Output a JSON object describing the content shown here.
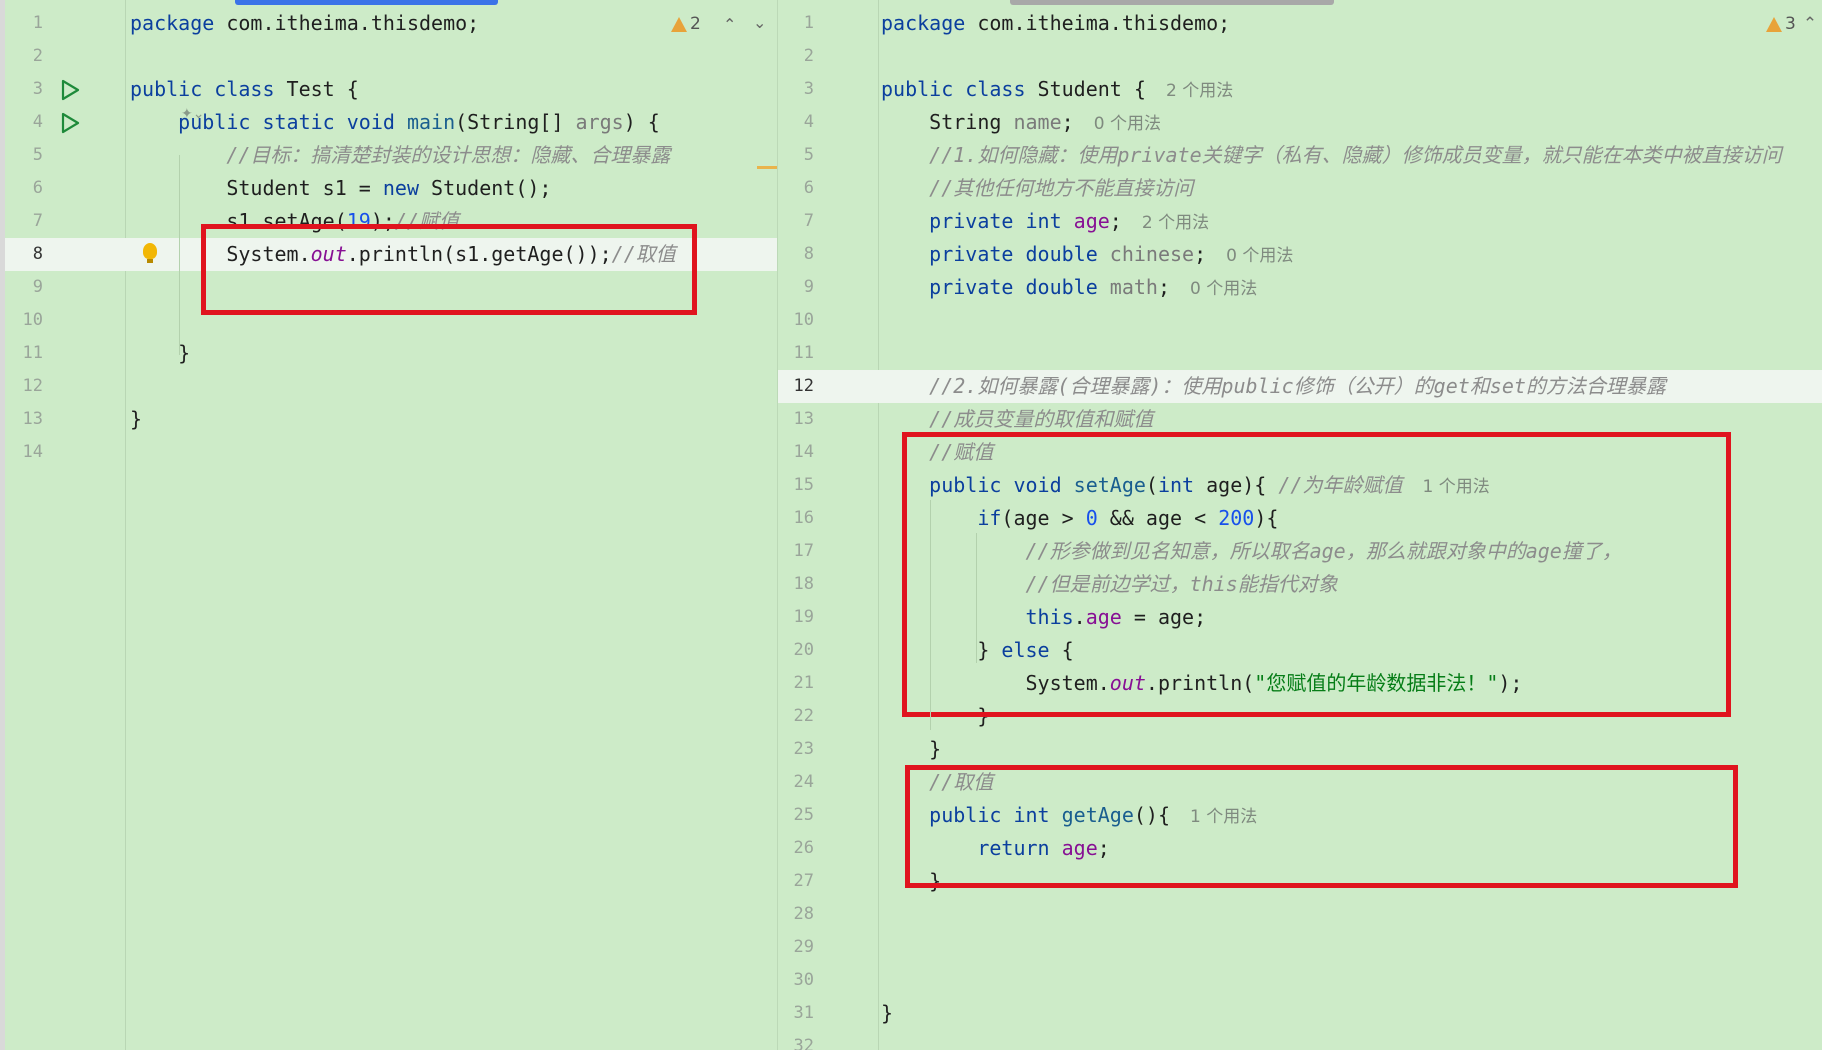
{
  "left": {
    "scrollbar_color": "#3b73e8",
    "warnings": {
      "icon": "warning-icon",
      "count": "2",
      "up_icon": "chevron-up-icon",
      "down_icon": "chevron-down-icon"
    },
    "lines": [
      {
        "n": "1",
        "tokens": [
          {
            "t": "package ",
            "c": "kw"
          },
          {
            "t": "com.itheima.thisdemo;",
            "c": ""
          }
        ]
      },
      {
        "n": "2",
        "tokens": []
      },
      {
        "n": "3",
        "tokens": [
          {
            "t": "public class ",
            "c": "kw"
          },
          {
            "t": "Test {",
            "c": ""
          }
        ],
        "run": true
      },
      {
        "n": "4",
        "tokens": [
          {
            "t": "    public static void ",
            "c": "kw"
          },
          {
            "t": "main",
            "c": "fn"
          },
          {
            "t": "(String[] ",
            "c": ""
          },
          {
            "t": "args",
            "c": "par"
          },
          {
            "t": ") {",
            "c": ""
          }
        ],
        "run": true
      },
      {
        "n": "5",
        "tokens": [
          {
            "t": "        //目标：搞清楚封装的设计思想：隐藏、合理暴露",
            "c": "cm"
          }
        ]
      },
      {
        "n": "6",
        "tokens": [
          {
            "t": "        Student s1 = ",
            "c": ""
          },
          {
            "t": "new ",
            "c": "kw"
          },
          {
            "t": "Student();",
            "c": ""
          }
        ]
      },
      {
        "n": "7",
        "tokens": [
          {
            "t": "        s1.setAge(",
            "c": ""
          },
          {
            "t": "19",
            "c": "num"
          },
          {
            "t": ");",
            "c": ""
          },
          {
            "t": "//赋值",
            "c": "cm"
          }
        ]
      },
      {
        "n": "8",
        "tokens": [
          {
            "t": "        System.",
            "c": ""
          },
          {
            "t": "out",
            "c": "st"
          },
          {
            "t": ".println(s1.getAge());",
            "c": ""
          },
          {
            "t": "//取值",
            "c": "cm"
          }
        ],
        "current": true,
        "bulb": true
      },
      {
        "n": "9",
        "tokens": []
      },
      {
        "n": "10",
        "tokens": []
      },
      {
        "n": "11",
        "tokens": [
          {
            "t": "    }",
            "c": ""
          }
        ]
      },
      {
        "n": "12",
        "tokens": []
      },
      {
        "n": "13",
        "tokens": [
          {
            "t": "}",
            "c": ""
          }
        ]
      },
      {
        "n": "14",
        "tokens": []
      }
    ]
  },
  "right": {
    "scrollbar_color": "#a8a8a8",
    "warnings": {
      "icon": "warning-icon",
      "count": "3"
    },
    "lines": [
      {
        "n": "1",
        "tokens": [
          {
            "t": "package ",
            "c": "kw"
          },
          {
            "t": "com.itheima.thisdemo;",
            "c": ""
          }
        ]
      },
      {
        "n": "2",
        "tokens": []
      },
      {
        "n": "3",
        "tokens": [
          {
            "t": "public class ",
            "c": "kw"
          },
          {
            "t": "Student { ",
            "c": ""
          }
        ],
        "hint": "2 个用法"
      },
      {
        "n": "4",
        "tokens": [
          {
            "t": "    String ",
            "c": ""
          },
          {
            "t": "name",
            "c": "par"
          },
          {
            "t": "; ",
            "c": ""
          }
        ],
        "hint": "0 个用法"
      },
      {
        "n": "5",
        "tokens": [
          {
            "t": "    //1.如何隐藏：使用private关键字（私有、隐藏）修饰成员变量，就只能在本类中被直接访问",
            "c": "cm"
          }
        ]
      },
      {
        "n": "6",
        "tokens": [
          {
            "t": "    //其他任何地方不能直接访问",
            "c": "cm"
          }
        ]
      },
      {
        "n": "7",
        "tokens": [
          {
            "t": "    private int ",
            "c": "kw"
          },
          {
            "t": "age",
            "c": "fld"
          },
          {
            "t": "; ",
            "c": ""
          }
        ],
        "hint": "2 个用法"
      },
      {
        "n": "8",
        "tokens": [
          {
            "t": "    private double ",
            "c": "kw"
          },
          {
            "t": "chinese",
            "c": "par"
          },
          {
            "t": "; ",
            "c": ""
          }
        ],
        "hint": "0 个用法"
      },
      {
        "n": "9",
        "tokens": [
          {
            "t": "    private double ",
            "c": "kw"
          },
          {
            "t": "math",
            "c": "par"
          },
          {
            "t": "; ",
            "c": ""
          }
        ],
        "hint": "0 个用法"
      },
      {
        "n": "10",
        "tokens": []
      },
      {
        "n": "11",
        "tokens": []
      },
      {
        "n": "12",
        "tokens": [
          {
            "t": "    //2.如何暴露(合理暴露)：使用public修饰（公开）的get和set的方法合理暴露",
            "c": "cm"
          }
        ],
        "current": true
      },
      {
        "n": "13",
        "tokens": [
          {
            "t": "    //成员变量的取值和赋值",
            "c": "cm"
          }
        ]
      },
      {
        "n": "14",
        "tokens": [
          {
            "t": "    //赋值",
            "c": "cm"
          }
        ]
      },
      {
        "n": "15",
        "tokens": [
          {
            "t": "    public void ",
            "c": "kw"
          },
          {
            "t": "setAge",
            "c": "fn"
          },
          {
            "t": "(",
            "c": ""
          },
          {
            "t": "int ",
            "c": "kw"
          },
          {
            "t": "age){ ",
            "c": ""
          },
          {
            "t": "//为年龄赋值 ",
            "c": "cm"
          }
        ],
        "hint": "1 个用法"
      },
      {
        "n": "16",
        "tokens": [
          {
            "t": "        ",
            "c": ""
          },
          {
            "t": "if",
            "c": "kw"
          },
          {
            "t": "(age > ",
            "c": ""
          },
          {
            "t": "0",
            "c": "num"
          },
          {
            "t": " && age < ",
            "c": ""
          },
          {
            "t": "200",
            "c": "num"
          },
          {
            "t": "){",
            "c": ""
          }
        ]
      },
      {
        "n": "17",
        "tokens": [
          {
            "t": "            //形参做到见名知意，所以取名age，那么就跟对象中的age撞了，",
            "c": "cm"
          }
        ]
      },
      {
        "n": "18",
        "tokens": [
          {
            "t": "            //但是前边学过，this能指代对象",
            "c": "cm"
          }
        ]
      },
      {
        "n": "19",
        "tokens": [
          {
            "t": "            ",
            "c": ""
          },
          {
            "t": "this",
            "c": "kw"
          },
          {
            "t": ".",
            "c": ""
          },
          {
            "t": "age",
            "c": "fld"
          },
          {
            "t": " = age;",
            "c": ""
          }
        ]
      },
      {
        "n": "20",
        "tokens": [
          {
            "t": "        } ",
            "c": ""
          },
          {
            "t": "else",
            "c": "kw"
          },
          {
            "t": " {",
            "c": ""
          }
        ]
      },
      {
        "n": "21",
        "tokens": [
          {
            "t": "            System.",
            "c": ""
          },
          {
            "t": "out",
            "c": "st"
          },
          {
            "t": ".println(",
            "c": ""
          },
          {
            "t": "\"您赋值的年龄数据非法！\"",
            "c": "str"
          },
          {
            "t": ");",
            "c": ""
          }
        ]
      },
      {
        "n": "22",
        "tokens": [
          {
            "t": "        }",
            "c": ""
          }
        ]
      },
      {
        "n": "23",
        "tokens": [
          {
            "t": "    }",
            "c": ""
          }
        ]
      },
      {
        "n": "24",
        "tokens": [
          {
            "t": "    //取值",
            "c": "cm"
          }
        ]
      },
      {
        "n": "25",
        "tokens": [
          {
            "t": "    public int ",
            "c": "kw"
          },
          {
            "t": "getAge",
            "c": "fn"
          },
          {
            "t": "(){ ",
            "c": ""
          }
        ],
        "hint": "1 个用法"
      },
      {
        "n": "26",
        "tokens": [
          {
            "t": "        ",
            "c": ""
          },
          {
            "t": "return ",
            "c": "kw"
          },
          {
            "t": "age",
            "c": "fld"
          },
          {
            "t": ";",
            "c": ""
          }
        ]
      },
      {
        "n": "27",
        "tokens": [
          {
            "t": "    }",
            "c": ""
          }
        ]
      },
      {
        "n": "28",
        "tokens": []
      },
      {
        "n": "29",
        "tokens": []
      },
      {
        "n": "30",
        "tokens": []
      },
      {
        "n": "31",
        "tokens": [
          {
            "t": "}",
            "c": ""
          }
        ]
      },
      {
        "n": "32",
        "tokens": []
      }
    ]
  },
  "highlight_color": "#e0141e"
}
